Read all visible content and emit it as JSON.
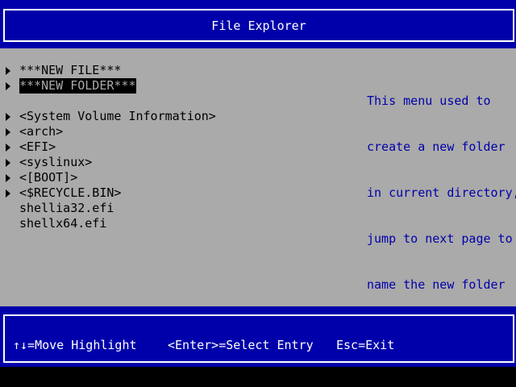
{
  "header": {
    "title": "File Explorer"
  },
  "entries": [
    {
      "label": "***NEW FILE***",
      "has_arrow": true,
      "highlighted": false
    },
    {
      "label": "***NEW FOLDER***",
      "has_arrow": true,
      "highlighted": true
    },
    {
      "label": "<System Volume Information>",
      "has_arrow": true,
      "highlighted": false
    },
    {
      "label": "<arch>",
      "has_arrow": true,
      "highlighted": false
    },
    {
      "label": "<EFI>",
      "has_arrow": true,
      "highlighted": false
    },
    {
      "label": "<syslinux>",
      "has_arrow": true,
      "highlighted": false
    },
    {
      "label": "<[BOOT]>",
      "has_arrow": true,
      "highlighted": false
    },
    {
      "label": "<$RECYCLE.BIN>",
      "has_arrow": true,
      "highlighted": false
    },
    {
      "label": "shellia32.efi",
      "has_arrow": false,
      "highlighted": false
    },
    {
      "label": "shellx64.efi",
      "has_arrow": false,
      "highlighted": false
    }
  ],
  "help": {
    "lines": [
      "This menu used to",
      "create a new folder",
      "in current directory,",
      "jump to next page to",
      "name the new folder"
    ]
  },
  "footer": {
    "move": "↑↓=Move Highlight",
    "select": "<Enter>=Select Entry",
    "exit": "Esc=Exit"
  },
  "colors": {
    "title_bg": "#0000aa",
    "body_bg": "#aaaaaa",
    "help_text": "#0000aa",
    "highlight_bg": "#000000"
  }
}
